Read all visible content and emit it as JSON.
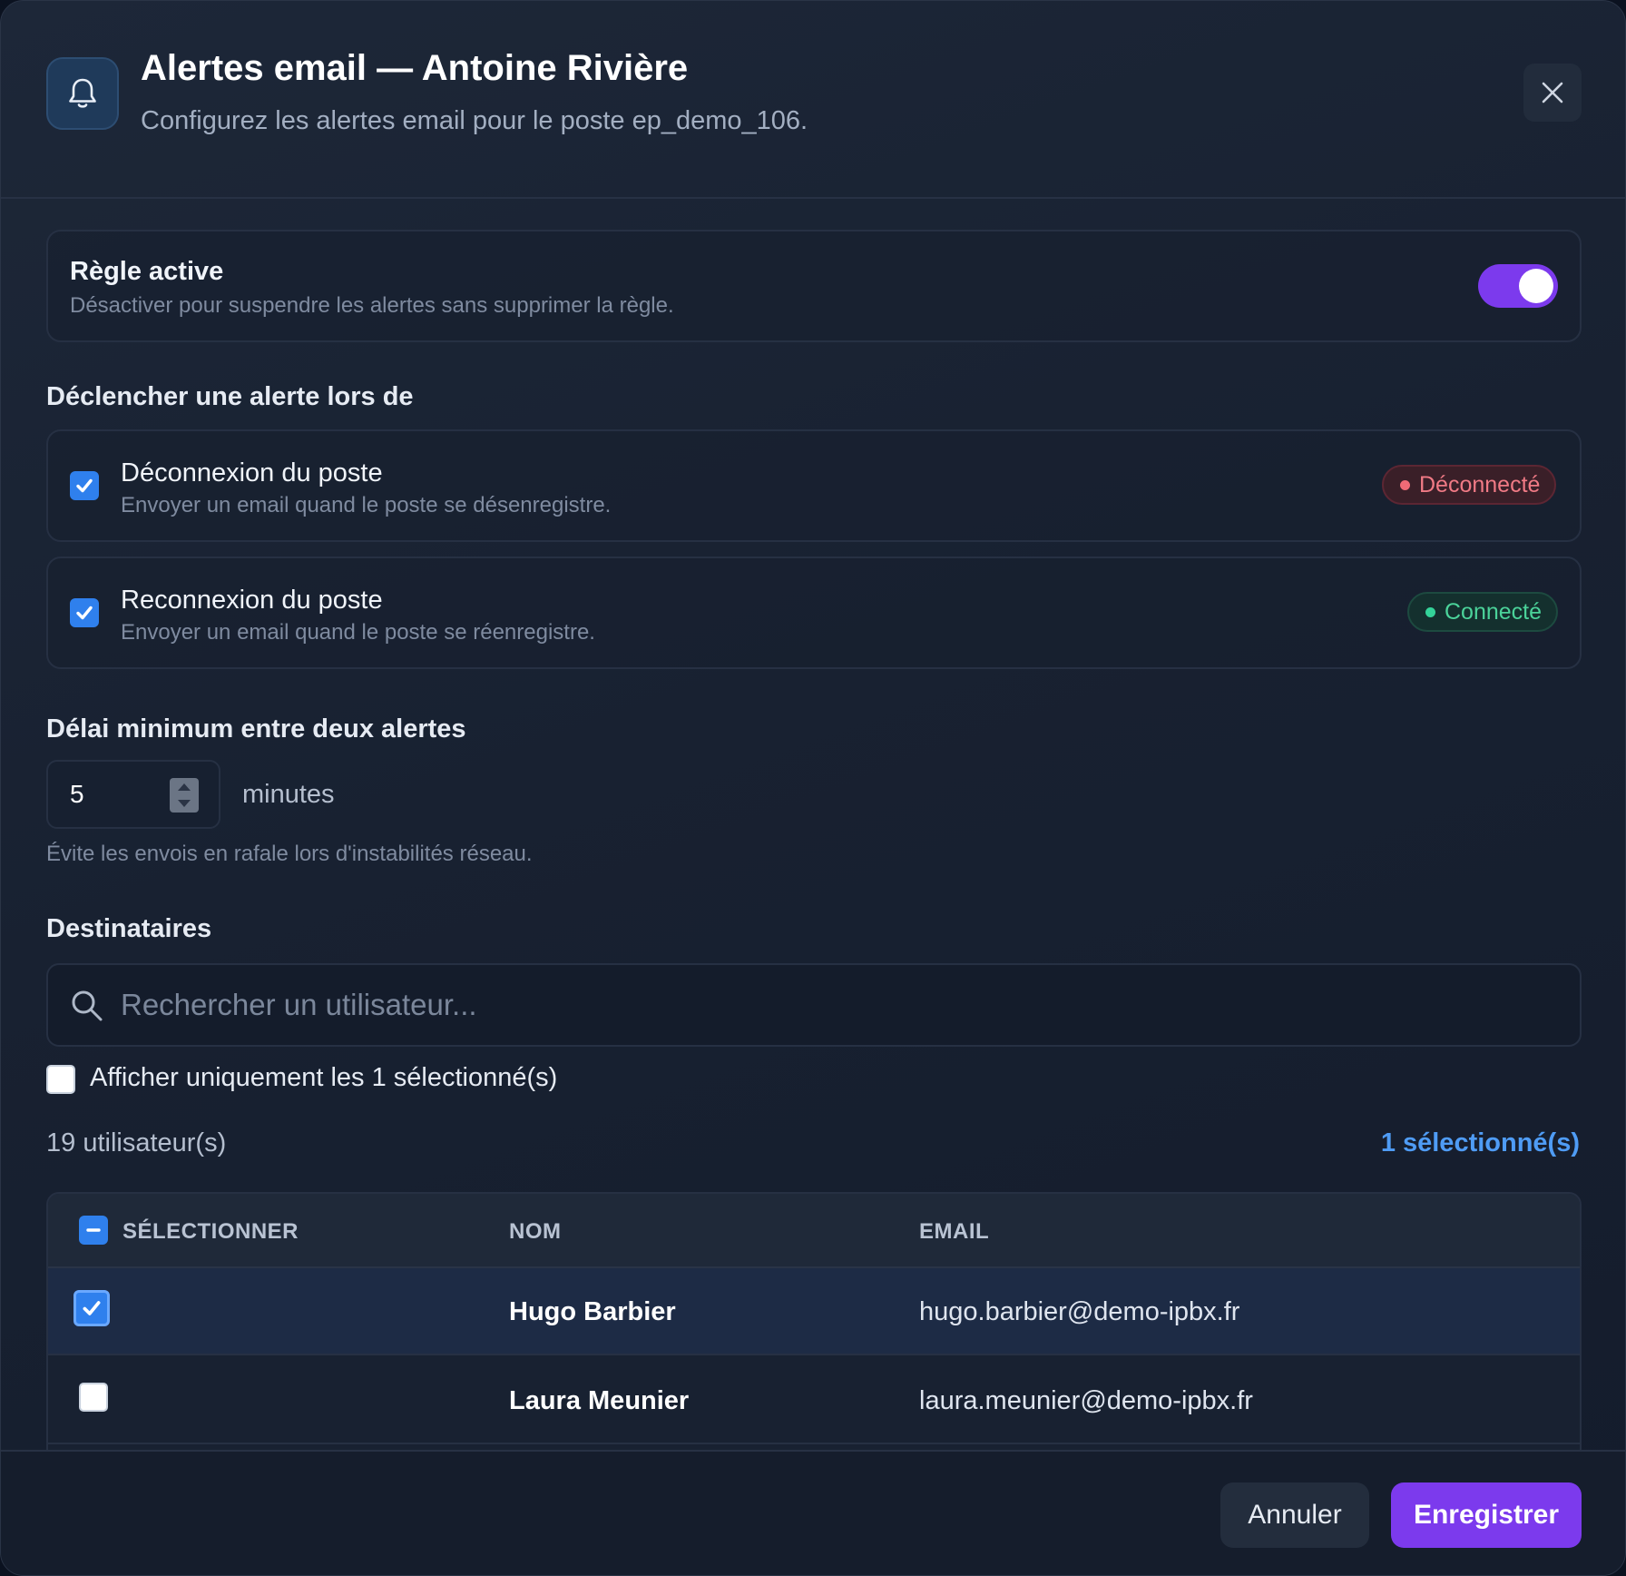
{
  "header": {
    "title": "Alertes email — Antoine Rivière",
    "subtitle": "Configurez les alertes email pour le poste ep_demo_106.",
    "icon": "bell-icon",
    "close_icon": "close-icon"
  },
  "rule": {
    "title": "Règle active",
    "description": "Désactiver pour suspendre les alertes sans supprimer la règle.",
    "enabled": true
  },
  "triggers": {
    "label": "Déclencher une alerte lors de",
    "items": [
      {
        "title": "Déconnexion du poste",
        "description": "Envoyer un email quand le poste se désenregistre.",
        "checked": true,
        "badge": "Déconnecté",
        "badge_color": "#f07a85"
      },
      {
        "title": "Reconnexion du poste",
        "description": "Envoyer un email quand le poste se réenregistre.",
        "checked": true,
        "badge": "Connecté",
        "badge_color": "#4bd39a"
      }
    ]
  },
  "delay": {
    "label": "Délai minimum entre deux alertes",
    "value": "5",
    "unit": "minutes",
    "hint": "Évite les envois en rafale lors d'instabilités réseau."
  },
  "recipients": {
    "label": "Destinataires",
    "search_placeholder": "Rechercher un utilisateur...",
    "filter_label": "Afficher uniquement les 1 sélectionné(s)",
    "count_label": "19 utilisateur(s)",
    "selected_label": "1 sélectionné(s)",
    "columns": [
      "SÉLECTIONNER",
      "NOM",
      "EMAIL"
    ],
    "rows": [
      {
        "name": "Hugo Barbier",
        "email": "hugo.barbier@demo-ipbx.fr",
        "selected": true
      },
      {
        "name": "Laura Meunier",
        "email": "laura.meunier@demo-ipbx.fr",
        "selected": false
      }
    ]
  },
  "footer": {
    "cancel_label": "Annuler",
    "save_label": "Enregistrer"
  },
  "colors": {
    "accent": "#7c3aed",
    "checkbox": "#2f80ed",
    "link": "#4f9cf5"
  }
}
